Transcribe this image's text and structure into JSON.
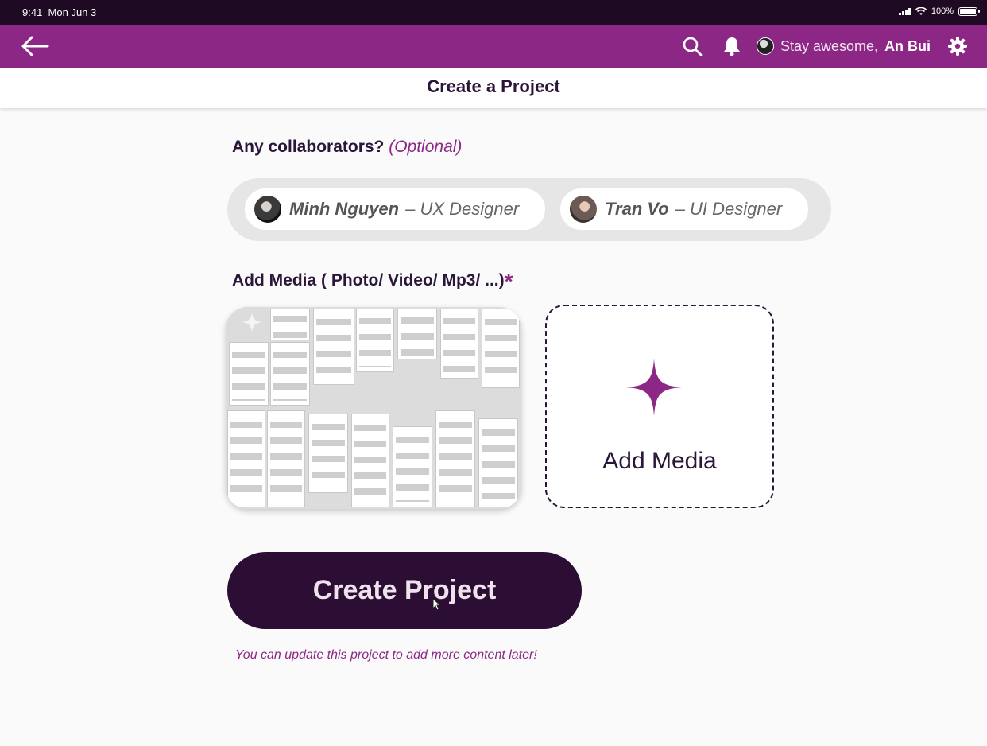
{
  "status_bar": {
    "time": "9:41",
    "date": "Mon Jun 3",
    "battery": "100%"
  },
  "header": {
    "greeting": "Stay awesome,",
    "user_name": "An Bui",
    "icons": [
      "back-arrow-icon",
      "search-icon",
      "bell-icon",
      "avatar",
      "settings-gear-icon"
    ]
  },
  "page": {
    "title": "Create a Project"
  },
  "collaborators": {
    "label": "Any collaborators?",
    "optional": "(Optional)",
    "people": [
      {
        "name": "Minh Nguyen",
        "role": "– UX Designer"
      },
      {
        "name": "Tran Vo",
        "role": "– UI Designer"
      }
    ]
  },
  "media": {
    "label": "Add Media  ( Photo/ Video/ Mp3/ ...)",
    "required_mark": "*",
    "add_label": "Add Media"
  },
  "actions": {
    "create_label": "Create Project",
    "hint": "You can update this project to add more content later!"
  },
  "colors": {
    "brand": "#8c2785",
    "dark": "#2c0d33",
    "status": "#1e0a22"
  }
}
